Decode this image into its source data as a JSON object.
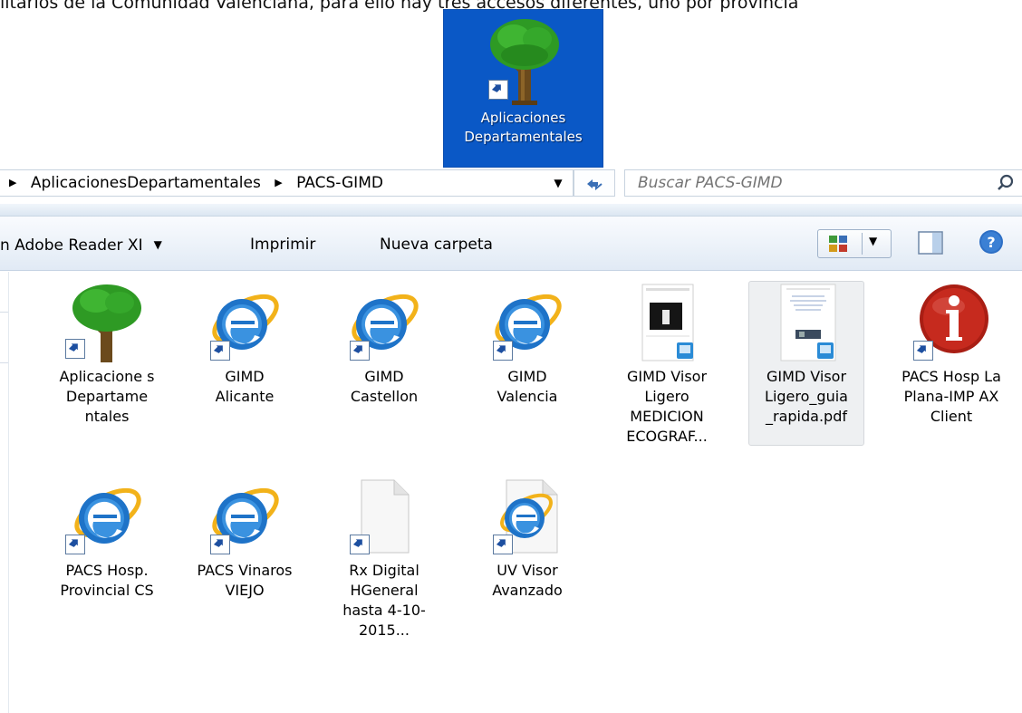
{
  "doc_text": "litarios de la Comunidad Valenciana, para ello hay tres accesos diferentes, uno por provincia",
  "desktop_shortcut": {
    "label_line1": "Aplicaciones",
    "label_line2": "Departamentales",
    "icon": "tree-icon"
  },
  "address_bar": {
    "crumbs": [
      "AplicacionesDepartamentales",
      "PACS-GIMD"
    ],
    "search_placeholder": "Buscar PACS-GIMD"
  },
  "toolbar": {
    "open_with": "n Adobe Reader XI",
    "print": "Imprimir",
    "new_folder": "Nueva carpeta"
  },
  "files": [
    {
      "label": "Aplicacione s Departame ntales",
      "icon": "tree-icon",
      "shortcut": true
    },
    {
      "label": "GIMD Alicante",
      "icon": "internet-explorer-icon",
      "shortcut": true
    },
    {
      "label": "GIMD Castellon",
      "icon": "internet-explorer-icon",
      "shortcut": true
    },
    {
      "label": "GIMD Valencia",
      "icon": "internet-explorer-icon",
      "shortcut": true
    },
    {
      "label": "GIMD Visor Ligero MEDICION ECOGRAF...",
      "icon": "document-thumbnail-icon",
      "shortcut": false
    },
    {
      "label": "GIMD Visor Ligero_guia _rapida.pdf",
      "icon": "pdf-thumbnail-icon",
      "shortcut": false,
      "selected": true
    },
    {
      "label": "PACS Hosp La Plana-IMP AX Client",
      "icon": "info-icon",
      "shortcut": true
    },
    {
      "label": "PACS Hosp. Provincial CS",
      "icon": "internet-explorer-icon",
      "shortcut": true
    },
    {
      "label": "PACS Vinaros VIEJO",
      "icon": "internet-explorer-icon",
      "shortcut": true
    },
    {
      "label": "Rx Digital HGeneral hasta 4-10-2015...",
      "icon": "blank-file-icon",
      "shortcut": true
    },
    {
      "label": "UV Visor Avanzado",
      "icon": "ie-file-icon",
      "shortcut": true
    }
  ],
  "colors": {
    "desktop_blue": "#0a58c6",
    "ie_blue": "#1e73c8",
    "ie_ring": "#f2b21a",
    "info_red": "#c62a1e",
    "tree_green": "#2e9a24"
  }
}
